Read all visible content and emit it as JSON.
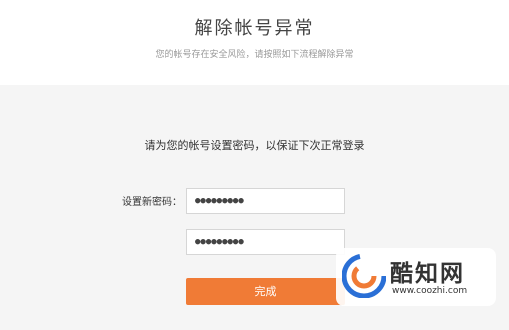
{
  "header": {
    "title": "解除帐号异常",
    "subtitle": "您的帐号存在安全风险，请按照如下流程解除异常"
  },
  "form": {
    "instruction": "请为您的帐号设置密码，以保证下次正常登录",
    "new_password_label": "设置新密码：",
    "new_password_value": "●●●●●●●●●",
    "confirm_password_value": "●●●●●●●●●",
    "submit_label": "完成"
  },
  "watermark": {
    "name": "酷知网",
    "url": "www.coozhi.com",
    "icon": "coozhi-logo-icon"
  },
  "colors": {
    "accent": "#f07b36",
    "panel_bg": "#f5f5f5",
    "logo_blue": "#2a6fd6",
    "logo_orange": "#f07b36"
  }
}
